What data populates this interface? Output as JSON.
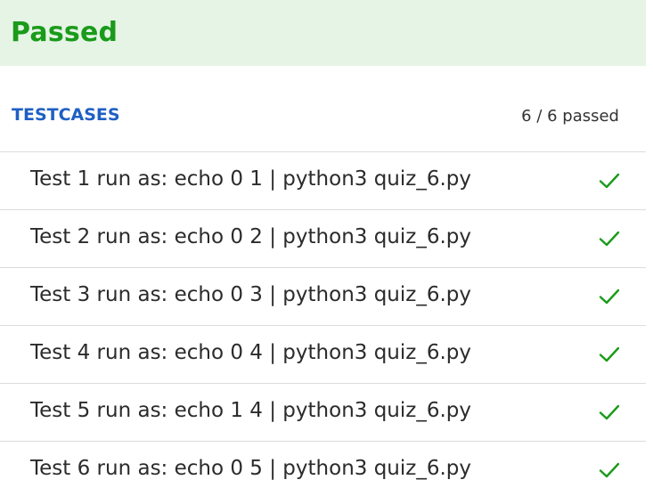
{
  "banner": {
    "status": "Passed",
    "status_color": "#1a9b1a",
    "background": "#e6f4e6"
  },
  "testcases": {
    "title": "TESTCASES",
    "summary": "6 / 6 passed",
    "items": [
      {
        "label": "Test 1 run as: echo 0 1 | python3 quiz_6.py",
        "status": "passed",
        "icon": "check-icon"
      },
      {
        "label": "Test 2 run as: echo 0 2 | python3 quiz_6.py",
        "status": "passed",
        "icon": "check-icon"
      },
      {
        "label": "Test 3 run as: echo 0 3 | python3 quiz_6.py",
        "status": "passed",
        "icon": "check-icon"
      },
      {
        "label": "Test 4 run as: echo 0 4 | python3 quiz_6.py",
        "status": "passed",
        "icon": "check-icon"
      },
      {
        "label": "Test 5 run as: echo 1 4 | python3 quiz_6.py",
        "status": "passed",
        "icon": "check-icon"
      },
      {
        "label": "Test 6 run as: echo 0 5 | python3 quiz_6.py",
        "status": "passed",
        "icon": "check-icon"
      }
    ]
  },
  "colors": {
    "accent_blue": "#1f5fc4",
    "success_green": "#1a9b1a"
  }
}
